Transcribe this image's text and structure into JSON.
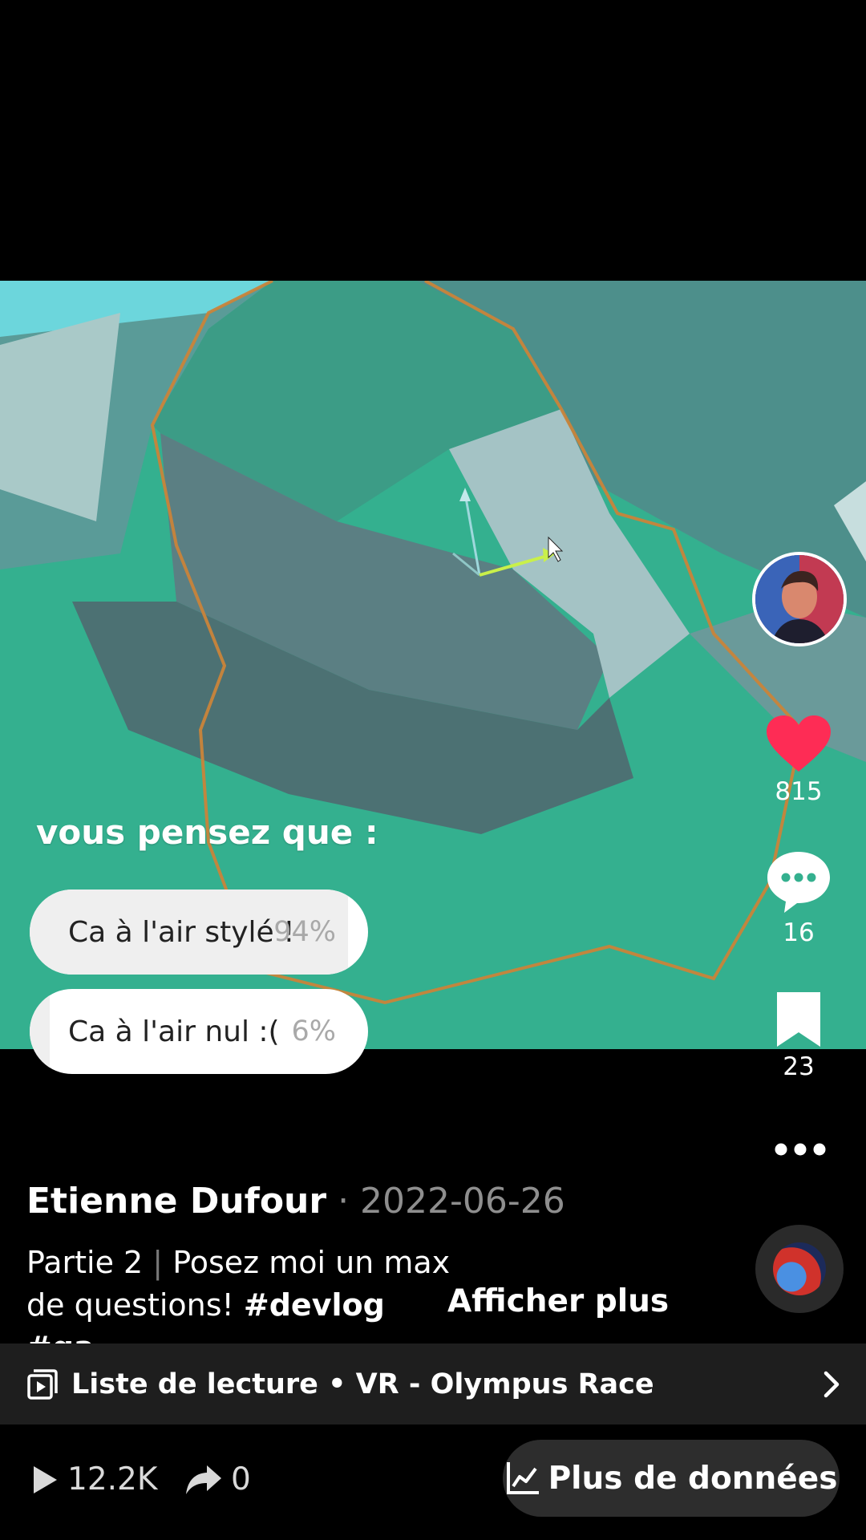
{
  "poll": {
    "question": "vous pensez que :",
    "options": [
      {
        "label": "Ca à l'air stylé !",
        "percent_label": "94%",
        "percent": 94
      },
      {
        "label": "Ca à l'air nul :(",
        "percent_label": "6%",
        "percent": 6
      }
    ]
  },
  "actions": {
    "likes": "815",
    "comments": "16",
    "saves": "23"
  },
  "post": {
    "author": "Etienne Dufour",
    "date_sep": " · ",
    "date": "2022-06-26",
    "caption_part": "Partie 2",
    "caption_sep": " | ",
    "caption_text": "Posez moi un max de questions! ",
    "caption_tags": "#devlog #ga...",
    "show_more": "Afficher plus"
  },
  "playlist": {
    "label": "Liste de lecture • VR - Olympus Race"
  },
  "stats": {
    "plays": "12.2K",
    "shares": "0",
    "more_data": "Plus de données"
  },
  "colors": {
    "like": "#fe2c55",
    "video_bg": "#34b08f"
  }
}
